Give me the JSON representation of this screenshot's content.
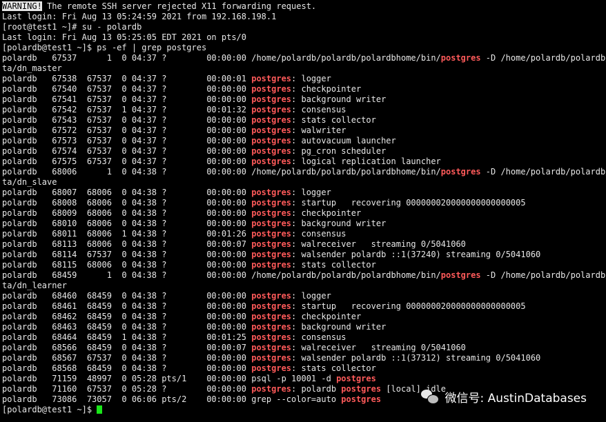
{
  "terminal": {
    "lines": [
      [
        {
          "t": "WARNING!",
          "c": "warn"
        },
        {
          "t": " The remote SSH server rejected X11 forwarding request."
        }
      ],
      [
        {
          "t": "Last login: Fri Aug 13 05:24:59 2021 from 192.168.198.1"
        }
      ],
      [
        {
          "t": "[root@test1 ~]# su - polardb"
        }
      ],
      [
        {
          "t": "Last login: Fri Aug 13 05:25:05 EDT 2021 on pts/0"
        }
      ],
      [
        {
          "t": "[polardb@test1 ~]$ ps -ef | grep postgres"
        }
      ],
      [
        {
          "t": "polardb   67537      1  0 04:37 ?        00:00:00 /home/polardb/polardb/polardbhome/bin/"
        },
        {
          "t": "postgres",
          "c": "hl"
        },
        {
          "t": " -D /home/polardb/polardb/da"
        }
      ],
      [
        {
          "t": "ta/dn_master"
        }
      ],
      [
        {
          "t": "polardb   67538  67537  0 04:37 ?        00:00:01 "
        },
        {
          "t": "postgres",
          "c": "hl"
        },
        {
          "t": ": logger"
        }
      ],
      [
        {
          "t": "polardb   67540  67537  0 04:37 ?        00:00:00 "
        },
        {
          "t": "postgres",
          "c": "hl"
        },
        {
          "t": ": checkpointer"
        }
      ],
      [
        {
          "t": "polardb   67541  67537  0 04:37 ?        00:00:00 "
        },
        {
          "t": "postgres",
          "c": "hl"
        },
        {
          "t": ": background writer"
        }
      ],
      [
        {
          "t": "polardb   67542  67537  1 04:37 ?        00:01:32 "
        },
        {
          "t": "postgres",
          "c": "hl"
        },
        {
          "t": ": consensus"
        }
      ],
      [
        {
          "t": "polardb   67543  67537  0 04:37 ?        00:00:00 "
        },
        {
          "t": "postgres",
          "c": "hl"
        },
        {
          "t": ": stats collector"
        }
      ],
      [
        {
          "t": "polardb   67572  67537  0 04:37 ?        00:00:00 "
        },
        {
          "t": "postgres",
          "c": "hl"
        },
        {
          "t": ": walwriter"
        }
      ],
      [
        {
          "t": "polardb   67573  67537  0 04:37 ?        00:00:00 "
        },
        {
          "t": "postgres",
          "c": "hl"
        },
        {
          "t": ": autovacuum launcher"
        }
      ],
      [
        {
          "t": "polardb   67574  67537  0 04:37 ?        00:00:00 "
        },
        {
          "t": "postgres",
          "c": "hl"
        },
        {
          "t": ": pg_cron scheduler"
        }
      ],
      [
        {
          "t": "polardb   67575  67537  0 04:37 ?        00:00:00 "
        },
        {
          "t": "postgres",
          "c": "hl"
        },
        {
          "t": ": logical replication launcher"
        }
      ],
      [
        {
          "t": "polardb   68006      1  0 04:38 ?        00:00:00 /home/polardb/polardb/polardbhome/bin/"
        },
        {
          "t": "postgres",
          "c": "hl"
        },
        {
          "t": " -D /home/polardb/polardb/da"
        }
      ],
      [
        {
          "t": "ta/dn_slave"
        }
      ],
      [
        {
          "t": "polardb   68007  68006  0 04:38 ?        00:00:00 "
        },
        {
          "t": "postgres",
          "c": "hl"
        },
        {
          "t": ": logger"
        }
      ],
      [
        {
          "t": "polardb   68008  68006  0 04:38 ?        00:00:00 "
        },
        {
          "t": "postgres",
          "c": "hl"
        },
        {
          "t": ": startup   recovering 000000020000000000000005"
        }
      ],
      [
        {
          "t": "polardb   68009  68006  0 04:38 ?        00:00:00 "
        },
        {
          "t": "postgres",
          "c": "hl"
        },
        {
          "t": ": checkpointer"
        }
      ],
      [
        {
          "t": "polardb   68010  68006  0 04:38 ?        00:00:00 "
        },
        {
          "t": "postgres",
          "c": "hl"
        },
        {
          "t": ": background writer"
        }
      ],
      [
        {
          "t": "polardb   68011  68006  1 04:38 ?        00:01:26 "
        },
        {
          "t": "postgres",
          "c": "hl"
        },
        {
          "t": ": consensus"
        }
      ],
      [
        {
          "t": "polardb   68113  68006  0 04:38 ?        00:00:07 "
        },
        {
          "t": "postgres",
          "c": "hl"
        },
        {
          "t": ": walreceiver   streaming 0/5041060"
        }
      ],
      [
        {
          "t": "polardb   68114  67537  0 04:38 ?        00:00:00 "
        },
        {
          "t": "postgres",
          "c": "hl"
        },
        {
          "t": ": walsender polardb ::1(37240) streaming 0/5041060"
        }
      ],
      [
        {
          "t": "polardb   68115  68006  0 04:38 ?        00:00:00 "
        },
        {
          "t": "postgres",
          "c": "hl"
        },
        {
          "t": ": stats collector"
        }
      ],
      [
        {
          "t": "polardb   68459      1  0 04:38 ?        00:00:00 /home/polardb/polardb/polardbhome/bin/"
        },
        {
          "t": "postgres",
          "c": "hl"
        },
        {
          "t": " -D /home/polardb/polardb/da"
        }
      ],
      [
        {
          "t": "ta/dn_learner"
        }
      ],
      [
        {
          "t": "polardb   68460  68459  0 04:38 ?        00:00:00 "
        },
        {
          "t": "postgres",
          "c": "hl"
        },
        {
          "t": ": logger"
        }
      ],
      [
        {
          "t": "polardb   68461  68459  0 04:38 ?        00:00:00 "
        },
        {
          "t": "postgres",
          "c": "hl"
        },
        {
          "t": ": startup   recovering 000000020000000000000005"
        }
      ],
      [
        {
          "t": "polardb   68462  68459  0 04:38 ?        00:00:00 "
        },
        {
          "t": "postgres",
          "c": "hl"
        },
        {
          "t": ": checkpointer"
        }
      ],
      [
        {
          "t": "polardb   68463  68459  0 04:38 ?        00:00:00 "
        },
        {
          "t": "postgres",
          "c": "hl"
        },
        {
          "t": ": background writer"
        }
      ],
      [
        {
          "t": "polardb   68464  68459  1 04:38 ?        00:01:25 "
        },
        {
          "t": "postgres",
          "c": "hl"
        },
        {
          "t": ": consensus"
        }
      ],
      [
        {
          "t": "polardb   68566  68459  0 04:38 ?        00:00:07 "
        },
        {
          "t": "postgres",
          "c": "hl"
        },
        {
          "t": ": walreceiver   streaming 0/5041060"
        }
      ],
      [
        {
          "t": "polardb   68567  67537  0 04:38 ?        00:00:00 "
        },
        {
          "t": "postgres",
          "c": "hl"
        },
        {
          "t": ": walsender polardb ::1(37312) streaming 0/5041060"
        }
      ],
      [
        {
          "t": "polardb   68568  68459  0 04:38 ?        00:00:00 "
        },
        {
          "t": "postgres",
          "c": "hl"
        },
        {
          "t": ": stats collector"
        }
      ],
      [
        {
          "t": "polardb   71159  48997  0 05:28 pts/1    00:00:00 psql -p 10001 -d "
        },
        {
          "t": "postgres",
          "c": "hl"
        }
      ],
      [
        {
          "t": "polardb   71160  67537  0 05:28 ?        00:00:00 "
        },
        {
          "t": "postgres",
          "c": "hl"
        },
        {
          "t": ": polardb "
        },
        {
          "t": "postgres",
          "c": "hl"
        },
        {
          "t": " [local] idle"
        }
      ],
      [
        {
          "t": "polardb   73086  73057  0 06:06 pts/2    00:00:00 grep --color=auto "
        },
        {
          "t": "postgres",
          "c": "hl"
        }
      ],
      [
        {
          "t": "[polardb@test1 ~]$ "
        },
        {
          "t": "",
          "c": "cursor"
        }
      ]
    ]
  },
  "watermark": {
    "icon": "wechat-icon",
    "text": "微信号: AustinDatabases"
  },
  "colors": {
    "background": "#000000",
    "foreground": "#e8e8e8",
    "highlight": "#ff5a5a",
    "cursor": "#19e619"
  }
}
